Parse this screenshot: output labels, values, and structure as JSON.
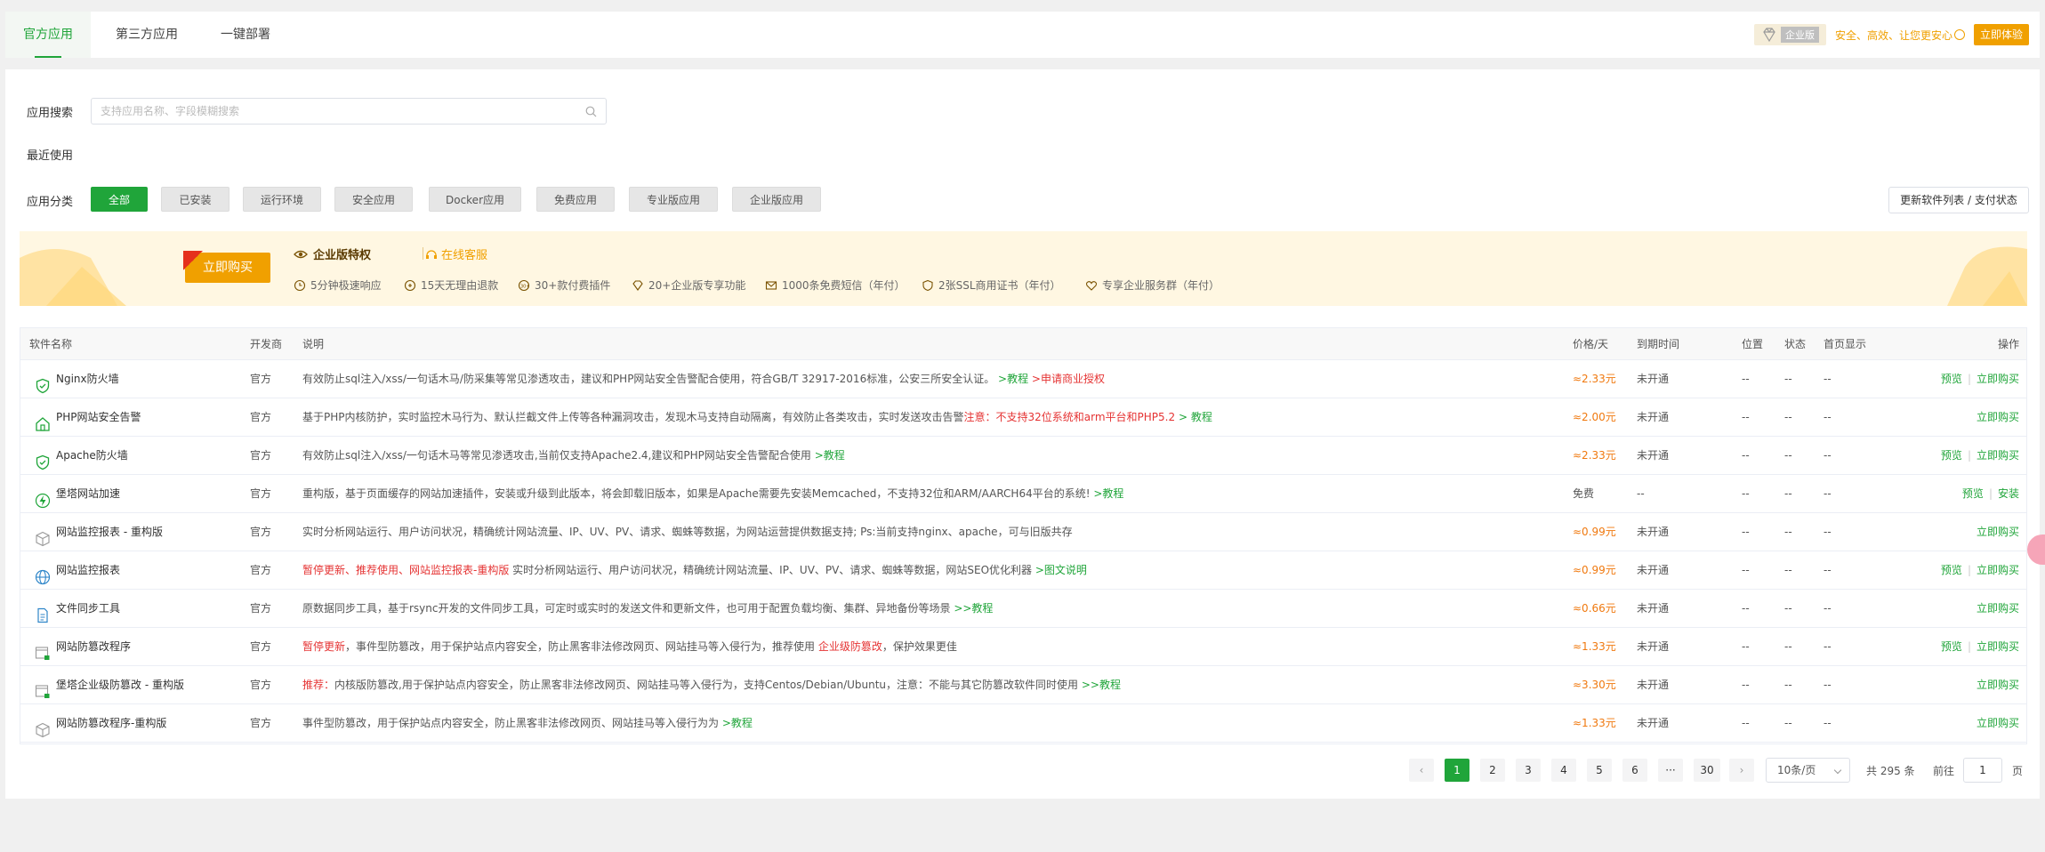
{
  "tabs": [
    {
      "label": "官方应用",
      "active": true
    },
    {
      "label": "第三方应用",
      "active": false
    },
    {
      "label": "一键部署",
      "active": false
    }
  ],
  "top_promo": {
    "badge": "企业版",
    "slogan": "安全、高效、让您更安心",
    "button": "立即体验"
  },
  "search": {
    "label": "应用搜索",
    "placeholder": "支持应用名称、字段模糊搜索"
  },
  "recent_label": "最近使用",
  "categories": {
    "label": "应用分类",
    "items": [
      "全部",
      "已安装",
      "运行环境",
      "安全应用",
      "Docker应用",
      "免费应用",
      "专业版应用",
      "企业版应用"
    ],
    "active_index": 0
  },
  "refresh_button": "更新软件列表 / 支付状态",
  "banner": {
    "buy_button": "立即购买",
    "title": "企业版特权",
    "service": "在线客服",
    "features": [
      "5分钟极速响应",
      "15天无理由退款",
      "30+款付费插件",
      "20+企业版专享功能",
      "1000条免费短信（年付）",
      "2张SSL商用证书（年付）",
      "专享企业服务群（年付）"
    ]
  },
  "table": {
    "headers": {
      "name": "软件名称",
      "dev": "开发商",
      "desc": "说明",
      "price": "价格/天",
      "expire": "到期时间",
      "pos": "位置",
      "status": "状态",
      "home": "首页显示",
      "ops": "操作"
    },
    "rows": [
      {
        "name": "Nginx防火墙",
        "icon": "firewall-icon",
        "dev": "官方",
        "desc": [
          [
            "有效防止sql注入/xss/一句话木马/防采集等常见渗透攻击，建议和PHP网站安全告警配合使用，符合GB/T 32917-2016标准，公安三所安全认证。",
            ""
          ],
          [
            " >教程",
            "g"
          ],
          [
            "  >申请商业授权",
            "r"
          ]
        ],
        "price": "≈2.33元",
        "expire": "未开通",
        "pos": "--",
        "status": "--",
        "home": "--",
        "ops": [
          "预览",
          "立即购买"
        ]
      },
      {
        "name": "PHP网站安全告警",
        "icon": "house-shield-icon",
        "dev": "官方",
        "desc": [
          [
            "基于PHP内核防护，实时监控木马行为、默认拦截文件上传等各种漏洞攻击，发现木马支持自动隔离，有效防止各类攻击，实时发送攻击告警",
            ""
          ],
          [
            "注意：不支持32位系统和arm平台和PHP5.2",
            "r"
          ],
          [
            "  > 教程",
            "g"
          ]
        ],
        "price": "≈2.00元",
        "expire": "未开通",
        "pos": "--",
        "status": "--",
        "home": "--",
        "ops": [
          "立即购买"
        ]
      },
      {
        "name": "Apache防火墙",
        "icon": "firewall-icon",
        "dev": "官方",
        "desc": [
          [
            "有效防止sql注入/xss/一句话木马等常见渗透攻击,当前仅支持Apache2.4,建议和PHP网站安全告警配合使用",
            ""
          ],
          [
            " >教程",
            "g"
          ]
        ],
        "price": "≈2.33元",
        "expire": "未开通",
        "pos": "--",
        "status": "--",
        "home": "--",
        "ops": [
          "预览",
          "立即购买"
        ]
      },
      {
        "name": "堡塔网站加速",
        "icon": "lightning-icon",
        "dev": "官方",
        "desc": [
          [
            "重构版，基于页面缓存的网站加速插件，安装或升级到此版本，将会卸载旧版本，如果是Apache需要先安装Memcached，不支持32位和ARM/AARCH64平台的系统!",
            ""
          ],
          [
            " >教程",
            "g"
          ]
        ],
        "price": "免费",
        "expire": "--",
        "pos": "--",
        "status": "--",
        "home": "--",
        "ops": [
          "预览",
          "安装"
        ]
      },
      {
        "name": "网站监控报表 - 重构版",
        "icon": "cube-icon",
        "dev": "官方",
        "desc": [
          [
            "实时分析网站运行、用户访问状况，精确统计网站流量、IP、UV、PV、请求、蜘蛛等数据，为网站运营提供数据支持; Ps:当前支持nginx、apache，可与旧版共存",
            ""
          ]
        ],
        "price": "≈0.99元",
        "expire": "未开通",
        "pos": "--",
        "status": "--",
        "home": "--",
        "ops": [
          "立即购买"
        ]
      },
      {
        "name": "网站监控报表",
        "icon": "globe-icon",
        "dev": "官方",
        "desc": [
          [
            "暂停更新、推荐使用、网站监控报表-重构版",
            "r"
          ],
          [
            " 实时分析网站运行、用户访问状况，精确统计网站流量、IP、UV、PV、请求、蜘蛛等数据，网站SEO优化利器",
            ""
          ],
          [
            " >图文说明",
            "g"
          ]
        ],
        "price": "≈0.99元",
        "expire": "未开通",
        "pos": "--",
        "status": "--",
        "home": "--",
        "ops": [
          "预览",
          "立即购买"
        ]
      },
      {
        "name": "文件同步工具",
        "icon": "file-sync-icon",
        "dev": "官方",
        "desc": [
          [
            "原数据同步工具，基于rsync开发的文件同步工具，可定时或实时的发送文件和更新文件，也可用于配置负载均衡、集群、异地备份等场景",
            ""
          ],
          [
            " >>教程",
            "g"
          ]
        ],
        "price": "≈0.66元",
        "expire": "未开通",
        "pos": "--",
        "status": "--",
        "home": "--",
        "ops": [
          "立即购买"
        ]
      },
      {
        "name": "网站防篡改程序",
        "icon": "window-lock-icon",
        "dev": "官方",
        "desc": [
          [
            "暂停更新",
            "r"
          ],
          [
            "，事件型防篡改，用于保护站点内容安全，防止黑客非法修改网页、网站挂马等入侵行为，推荐使用 ",
            ""
          ],
          [
            "企业级防篡改",
            "r"
          ],
          [
            "，保护效果更佳",
            ""
          ]
        ],
        "price": "≈1.33元",
        "expire": "未开通",
        "pos": "--",
        "status": "--",
        "home": "--",
        "ops": [
          "预览",
          "立即购买"
        ]
      },
      {
        "name": "堡塔企业级防篡改 - 重构版",
        "icon": "window-lock-icon",
        "dev": "官方",
        "desc": [
          [
            "推荐：",
            "r"
          ],
          [
            "内核版防篡改,用于保护站点内容安全，防止黑客非法修改网页、网站挂马等入侵行为，支持Centos/Debian/Ubuntu，注意：不能与其它防篡改软件同时使用",
            ""
          ],
          [
            " >>教程",
            "g"
          ]
        ],
        "price": "≈3.30元",
        "expire": "未开通",
        "pos": "--",
        "status": "--",
        "home": "--",
        "ops": [
          "立即购买"
        ]
      },
      {
        "name": "网站防篡改程序-重构版",
        "icon": "cube-icon",
        "dev": "官方",
        "desc": [
          [
            "事件型防篡改，用于保护站点内容安全，防止黑客非法修改网页、网站挂马等入侵行为为",
            ""
          ],
          [
            " >教程",
            "g"
          ]
        ],
        "price": "≈1.33元",
        "expire": "未开通",
        "pos": "--",
        "status": "--",
        "home": "--",
        "ops": [
          "立即购买"
        ]
      }
    ]
  },
  "pagination": {
    "pages": [
      "1",
      "2",
      "3",
      "4",
      "5",
      "6",
      "···",
      "30"
    ],
    "current": "1",
    "page_size": "10条/页",
    "total": "共 295 条",
    "goto_prefix": "前往",
    "goto_value": "1",
    "goto_suffix": "页"
  },
  "colors": {
    "accent": "#20a53a",
    "warn": "#f0a000",
    "danger": "#e53333",
    "price": "#f0790f"
  }
}
